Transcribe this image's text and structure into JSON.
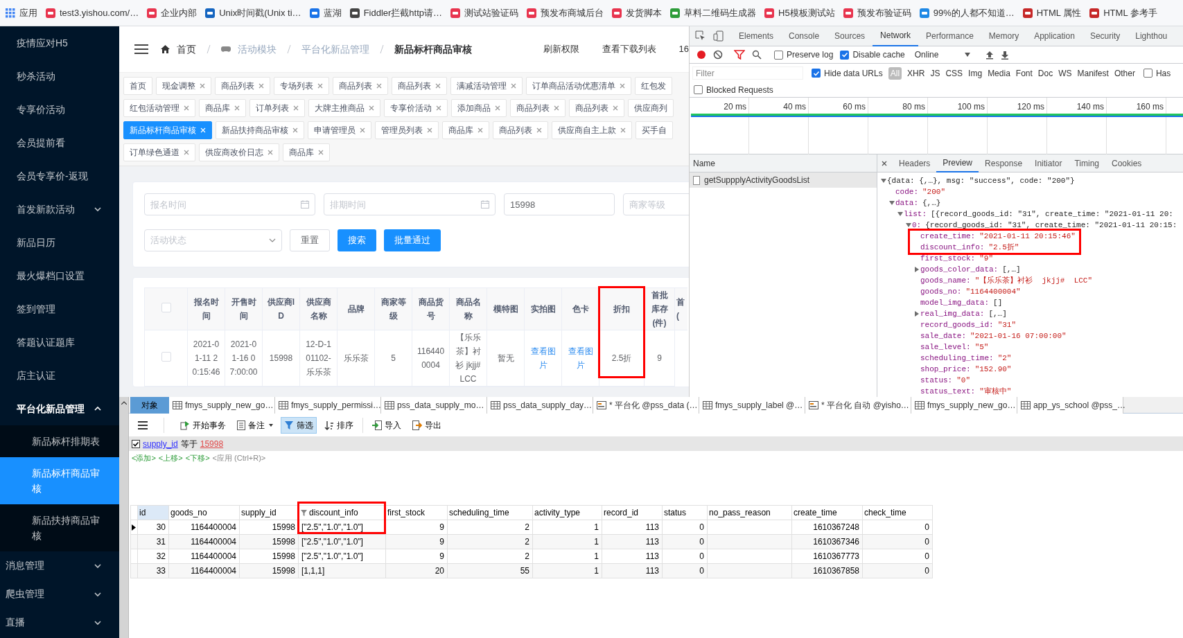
{
  "bookmarks": [
    {
      "label": "应用",
      "kind": "apps"
    },
    {
      "label": "test3.yishou.com/…",
      "kind": "site",
      "color": "#e8344e"
    },
    {
      "label": "企业内部",
      "kind": "site",
      "color": "#e8344e"
    },
    {
      "label": "Unix时间戳(Unix ti…",
      "kind": "site",
      "color": "#1565c0"
    },
    {
      "label": "蓝湖",
      "kind": "site",
      "color": "#1a73e8"
    },
    {
      "label": "Fiddler拦截http请…",
      "kind": "site",
      "color": "#444444"
    },
    {
      "label": "测试站验证码",
      "kind": "site",
      "color": "#e8344e"
    },
    {
      "label": "预发布商城后台",
      "kind": "site",
      "color": "#e8344e"
    },
    {
      "label": "发货脚本",
      "kind": "site",
      "color": "#e8344e"
    },
    {
      "label": "草料二维码生成器",
      "kind": "site",
      "color": "#2e9d3a"
    },
    {
      "label": "H5模板测试站",
      "kind": "site",
      "color": "#e8344e"
    },
    {
      "label": "预发布验证码",
      "kind": "site",
      "color": "#e8344e"
    },
    {
      "label": "99%的人都不知道…",
      "kind": "site",
      "color": "#1e88e5"
    },
    {
      "label": "HTML 属性",
      "kind": "site",
      "color": "#c62828"
    },
    {
      "label": "HTML 参考手",
      "kind": "site",
      "color": "#c62828"
    }
  ],
  "sidebar": {
    "items": [
      {
        "label": "疫情应对H5"
      },
      {
        "label": "秒杀活动"
      },
      {
        "label": "专享价活动"
      },
      {
        "label": "会员提前看"
      },
      {
        "label": "会员专享价-返现"
      },
      {
        "label": "首发新款活动",
        "expanded": false
      },
      {
        "label": "新品日历"
      },
      {
        "label": "最火爆档口设置"
      },
      {
        "label": "签到管理"
      },
      {
        "label": "答题认证题库"
      },
      {
        "label": "店主认证"
      },
      {
        "label": "平台化新品管理",
        "expanded": true,
        "children": [
          {
            "label": "新品标杆排期表",
            "selected": false
          },
          {
            "label": "新品标杆商品审核",
            "selected": true
          },
          {
            "label": "新品扶持商品审核",
            "selected": false
          }
        ]
      },
      {
        "label": "消息管理",
        "expanded": false
      },
      {
        "label": "爬虫管理",
        "expanded": false
      },
      {
        "label": "直播",
        "expanded": false
      }
    ]
  },
  "header": {
    "breadcrumbs": [
      {
        "label": "首页",
        "kind": "home",
        "current": false
      },
      {
        "label": "活动模块",
        "kind": "module",
        "current": false
      },
      {
        "label": "平台化新品管理",
        "current": false
      },
      {
        "label": "新品标杆商品审核",
        "current": true
      }
    ],
    "links": [
      "刷新权限",
      "查看下载列表",
      "16"
    ]
  },
  "tab_rows": [
    [
      {
        "label": "首页",
        "selected": false,
        "closable": false
      },
      {
        "label": "现金调整",
        "selected": false,
        "closable": true
      },
      {
        "label": "商品列表",
        "selected": false,
        "closable": true
      },
      {
        "label": "专场列表",
        "selected": false,
        "closable": true
      },
      {
        "label": "商品列表",
        "selected": false,
        "closable": true
      },
      {
        "label": "商品列表",
        "selected": false,
        "closable": true
      },
      {
        "label": "满减活动管理",
        "selected": false,
        "closable": true
      },
      {
        "label": "订单商品活动优惠清单",
        "selected": false,
        "closable": true
      },
      {
        "label": "红包发",
        "selected": false,
        "closable": false
      }
    ],
    [
      {
        "label": "红包活动管理",
        "selected": false,
        "closable": true
      },
      {
        "label": "商品库",
        "selected": false,
        "closable": true
      },
      {
        "label": "订单列表",
        "selected": false,
        "closable": true
      },
      {
        "label": "大牌主推商品",
        "selected": false,
        "closable": true
      },
      {
        "label": "专享价活动",
        "selected": false,
        "closable": true
      },
      {
        "label": "添加商品",
        "selected": false,
        "closable": true
      },
      {
        "label": "商品列表",
        "selected": false,
        "closable": true
      },
      {
        "label": "商品列表",
        "selected": false,
        "closable": true
      },
      {
        "label": "供应商列",
        "selected": false,
        "closable": false
      }
    ],
    [
      {
        "label": "新品标杆商品审核",
        "selected": true,
        "closable": true
      },
      {
        "label": "新品扶持商品审核",
        "selected": false,
        "closable": true
      },
      {
        "label": "申请管理员",
        "selected": false,
        "closable": true
      },
      {
        "label": "管理员列表",
        "selected": false,
        "closable": true
      },
      {
        "label": "商品库",
        "selected": false,
        "closable": true
      },
      {
        "label": "商品列表",
        "selected": false,
        "closable": true
      },
      {
        "label": "供应商自主上款",
        "selected": false,
        "closable": true
      },
      {
        "label": "买手自",
        "selected": false,
        "closable": false
      }
    ],
    [
      {
        "label": "订单绿色通道",
        "selected": false,
        "closable": true
      },
      {
        "label": "供应商改价日志",
        "selected": false,
        "closable": true
      },
      {
        "label": "商品库",
        "selected": false,
        "closable": true
      }
    ]
  ],
  "search_form": {
    "fields": [
      {
        "kind": "date",
        "placeholder": "报名时间"
      },
      {
        "kind": "date",
        "placeholder": "排期时间"
      },
      {
        "kind": "text",
        "value": "15998"
      },
      {
        "kind": "text",
        "placeholder": "商家等级"
      }
    ],
    "status_select": {
      "placeholder": "活动状态"
    },
    "buttons": [
      {
        "label": "重置",
        "kind": "default"
      },
      {
        "label": "搜索",
        "kind": "primary"
      },
      {
        "label": "批量通过",
        "kind": "primary"
      }
    ]
  },
  "goods_table": {
    "all_checked": false,
    "columns": [
      {
        "label": "报名时间"
      },
      {
        "label": "开售时间"
      },
      {
        "label": "供应商ID"
      },
      {
        "label": "供应商名称"
      },
      {
        "label": "品牌"
      },
      {
        "label": "商家等级"
      },
      {
        "label": "商品货号"
      },
      {
        "label": "商品名称"
      },
      {
        "label": "模特图"
      },
      {
        "label": "实拍图",
        "kind": "link"
      },
      {
        "label": "色卡",
        "kind": "link"
      },
      {
        "label": "折扣",
        "highlighted": true
      },
      {
        "label": "首批库存(件)"
      },
      {
        "label": "首("
      }
    ],
    "rows": [
      {
        "checked": false,
        "cells": [
          "2021-01-11 20:15:46",
          "2021-01-16 07:00:00",
          "15998",
          "12-D-101102-乐乐茶",
          "乐乐茶",
          "5",
          "1164400004",
          "【乐乐茶】衬衫 jkjj# LCC",
          "暂无",
          "查看图片",
          "查看图片",
          "2.5折",
          "9"
        ]
      }
    ]
  },
  "devtools": {
    "panel_tabs": [
      {
        "label": "Elements",
        "selected": false
      },
      {
        "label": "Console",
        "selected": false
      },
      {
        "label": "Sources",
        "selected": false
      },
      {
        "label": "Network",
        "selected": true
      },
      {
        "label": "Performance",
        "selected": false
      },
      {
        "label": "Memory",
        "selected": false
      },
      {
        "label": "Application",
        "selected": false
      },
      {
        "label": "Security",
        "selected": false
      },
      {
        "label": "Lighthou",
        "selected": false
      }
    ],
    "recording": true,
    "preserve_log": {
      "label": "Preserve log",
      "checked": false
    },
    "disable_cache": {
      "label": "Disable cache",
      "checked": true
    },
    "throttling": "Online",
    "filter": {
      "placeholder": "Filter"
    },
    "hide_data_urls": {
      "label": "Hide data URLs",
      "checked": true
    },
    "types": [
      {
        "label": "All",
        "selected": true
      },
      {
        "label": "XHR",
        "selected": false
      },
      {
        "label": "JS",
        "selected": false
      },
      {
        "label": "CSS",
        "selected": false
      },
      {
        "label": "Img",
        "selected": false
      },
      {
        "label": "Media",
        "selected": false
      },
      {
        "label": "Font",
        "selected": false
      },
      {
        "label": "Doc",
        "selected": false
      },
      {
        "label": "WS",
        "selected": false
      },
      {
        "label": "Manifest",
        "selected": false
      },
      {
        "label": "Other",
        "selected": false
      }
    ],
    "has_blocked": {
      "label": "Has",
      "checked": false
    },
    "blocked_requests": {
      "label": "Blocked Requests",
      "checked": false
    },
    "ticks": [
      "20 ms",
      "40 ms",
      "60 ms",
      "80 ms",
      "100 ms",
      "120 ms",
      "140 ms",
      "160 ms"
    ],
    "requests": {
      "header": "Name",
      "items": [
        {
          "label": "getSuppplyActivityGoodsList",
          "selected": true
        }
      ]
    },
    "detail_tabs": [
      {
        "label": "Headers",
        "selected": false
      },
      {
        "label": "Preview",
        "selected": true
      },
      {
        "label": "Response",
        "selected": false
      },
      {
        "label": "Initiator",
        "selected": false
      },
      {
        "label": "Timing",
        "selected": false
      },
      {
        "label": "Cookies",
        "selected": false
      }
    ],
    "tree": [
      {
        "value": "{data: {,…}, msg: \"success\", code: \"200\"}",
        "kind": "object",
        "expanded": true,
        "children": [
          {
            "key": "code:",
            "value": "\"200\"",
            "kind": "string"
          },
          {
            "key": "data:",
            "value": "{,…}",
            "kind": "object",
            "expanded": true,
            "children": [
              {
                "key": "list:",
                "value": "[{record_goods_id: \"31\", create_time: \"2021-01-11 20:",
                "kind": "object",
                "expanded": true,
                "children": [
                  {
                    "key": "0:",
                    "value": "{record_goods_id: \"31\", create_time: \"2021-01-11 20:15:",
                    "kind": "object",
                    "expanded": true,
                    "children": [
                      {
                        "key": "create_time:",
                        "value": "\"2021-01-11 20:15:46\"",
                        "kind": "string",
                        "highlighted": true
                      },
                      {
                        "key": "discount_info:",
                        "value": "\"2.5折\"",
                        "kind": "string",
                        "highlighted": true
                      },
                      {
                        "key": "first_stock:",
                        "value": "\"9\"",
                        "kind": "string"
                      },
                      {
                        "key": "goods_color_data:",
                        "value": "[,…]",
                        "kind": "object",
                        "expanded": false
                      },
                      {
                        "key": "goods_name:",
                        "value": "\"【乐乐茶】衬衫  jkjj#  LCC\"",
                        "kind": "string"
                      },
                      {
                        "key": "goods_no:",
                        "value": "\"1164400004\"",
                        "kind": "string"
                      },
                      {
                        "key": "model_img_data:",
                        "value": "[]",
                        "kind": "object"
                      },
                      {
                        "key": "real_img_data:",
                        "value": "[,…]",
                        "kind": "object",
                        "expanded": false
                      },
                      {
                        "key": "record_goods_id:",
                        "value": "\"31\"",
                        "kind": "string"
                      },
                      {
                        "key": "sale_date:",
                        "value": "\"2021-01-16 07:00:00\"",
                        "kind": "string"
                      },
                      {
                        "key": "sale_level:",
                        "value": "\"5\"",
                        "kind": "string"
                      },
                      {
                        "key": "scheduling_time:",
                        "value": "\"2\"",
                        "kind": "string"
                      },
                      {
                        "key": "shop_price:",
                        "value": "\"152.90\"",
                        "kind": "string"
                      },
                      {
                        "key": "status:",
                        "value": "\"0\"",
                        "kind": "string"
                      },
                      {
                        "key": "status_text:",
                        "value": "\"审核中\"",
                        "kind": "string"
                      }
                    ]
                  }
                ]
              }
            ]
          }
        ]
      }
    ]
  },
  "navicat": {
    "tabs": [
      {
        "label": "对象",
        "kind": "object",
        "selected": true
      },
      {
        "label": "fmys_supply_new_go…",
        "kind": "table",
        "selected": false
      },
      {
        "label": "fmys_supply_permissi…",
        "kind": "table",
        "selected": false
      },
      {
        "label": "pss_data_supply_mo…",
        "kind": "table",
        "selected": false
      },
      {
        "label": "pss_data_supply_day…",
        "kind": "table",
        "selected": false
      },
      {
        "label": "* 平台化 @pss_data (…",
        "kind": "query",
        "selected": false
      },
      {
        "label": "fmys_supply_label @…",
        "kind": "table",
        "selected": false
      },
      {
        "label": "* 平台化 自动 @yisho…",
        "kind": "query",
        "selected": false
      },
      {
        "label": "fmys_supply_new_go…",
        "kind": "table",
        "selected": false
      },
      {
        "label": "app_ys_school @pss_…",
        "kind": "table",
        "selected": false
      }
    ],
    "toolbar": [
      {
        "kind": "menu",
        "active": false
      },
      {
        "label": "开始事务",
        "kind": "transaction",
        "active": false
      },
      {
        "label": "备注",
        "kind": "note",
        "active": false
      },
      {
        "label": "筛选",
        "kind": "filter",
        "active": true
      },
      {
        "label": "排序",
        "kind": "sort",
        "active": false
      },
      {
        "label": "导入",
        "kind": "import",
        "active": false
      },
      {
        "label": "导出",
        "kind": "export",
        "active": false
      }
    ],
    "filter": {
      "checked": true,
      "field": "supply_id",
      "operator": "等于",
      "value": "15998"
    },
    "filter_actions": [
      {
        "label": "<添加>",
        "kind": "action"
      },
      {
        "label": "<上移>",
        "kind": "action"
      },
      {
        "label": "<下移>",
        "kind": "action"
      },
      {
        "label": "<应用 (Ctrl+R)>",
        "kind": "hint"
      }
    ],
    "grid": {
      "columns": [
        {
          "label": "id",
          "kind": "number"
        },
        {
          "label": "goods_no",
          "kind": "number"
        },
        {
          "label": "supply_id",
          "kind": "number"
        },
        {
          "label": "discount_info",
          "kind": "text",
          "filtered": true,
          "highlighted": true
        },
        {
          "label": "first_stock",
          "kind": "number"
        },
        {
          "label": "scheduling_time",
          "kind": "number"
        },
        {
          "label": "activity_type",
          "kind": "number"
        },
        {
          "label": "record_id",
          "kind": "number"
        },
        {
          "label": "status",
          "kind": "number"
        },
        {
          "label": "no_pass_reason",
          "kind": "text"
        },
        {
          "label": "create_time",
          "kind": "number"
        },
        {
          "label": "check_time",
          "kind": "number"
        }
      ],
      "rows": [
        {
          "selected": true,
          "cells": [
            "30",
            "1164400004",
            "15998",
            "[\"2.5\",\"1.0\",\"1.0\"]",
            "9",
            "2",
            "1",
            "113",
            "0",
            "",
            "1610367248",
            "0"
          ]
        },
        {
          "selected": false,
          "cells": [
            "31",
            "1164400004",
            "15998",
            "[\"2.5\",\"1.0\",\"1.0\"]",
            "9",
            "2",
            "1",
            "113",
            "0",
            "",
            "1610367346",
            "0"
          ]
        },
        {
          "selected": false,
          "cells": [
            "32",
            "1164400004",
            "15998",
            "[\"2.5\",\"1.0\",\"1.0\"]",
            "9",
            "2",
            "1",
            "113",
            "0",
            "",
            "1610367773",
            "0"
          ]
        },
        {
          "selected": false,
          "cells": [
            "33",
            "1164400004",
            "15998",
            "[1,1,1]",
            "20",
            "55",
            "1",
            "113",
            "0",
            "",
            "1610367858",
            "0"
          ]
        }
      ]
    }
  }
}
